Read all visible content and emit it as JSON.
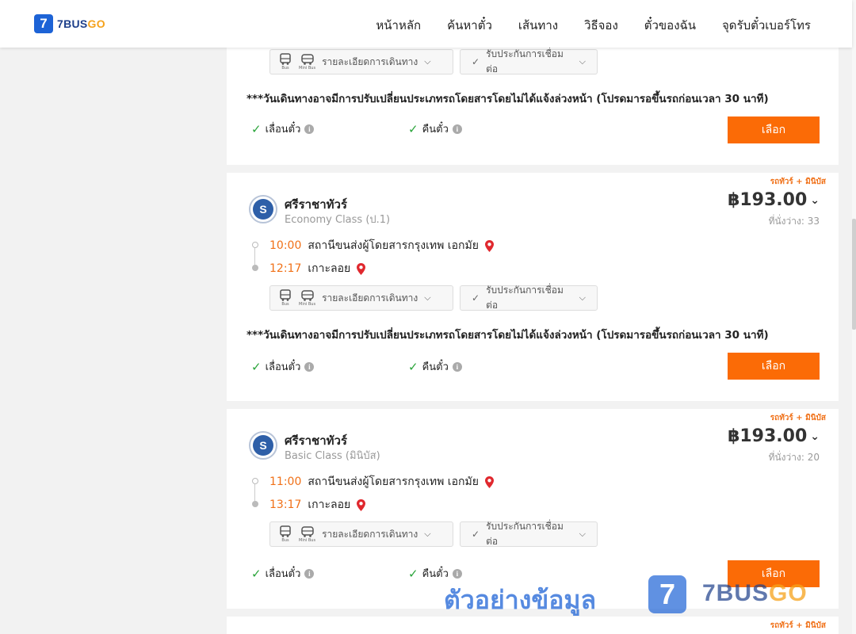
{
  "header": {
    "logo_mark": "7",
    "logo_main": "7BUS",
    "logo_accent": "GO",
    "nav": [
      "หน้าหลัก",
      "ค้นหาตั๋ว",
      "เส้นทาง",
      "วิธีจอง",
      "ตั๋วของฉัน",
      "จุดรับตั๋วเบอร์โทร"
    ]
  },
  "common": {
    "bus_label": "Bus",
    "minibus_label": "Mini Bus",
    "trip_details": "รายละเอียดการเดินทาง",
    "insurance": "รับประกันการเชื่อมต่อ",
    "notice": "***วันเดินทางอาจมีการปรับเปลี่ยนประเภทรถโดยสารโดยไม่ได้แจ้งล่วงหน้า (โปรดมารอขึ้นรถก่อนเวลา 30 นาที)",
    "reschedule": "เลื่อนตั๋ว",
    "refund": "คืนตั๋ว",
    "select": "เลือก",
    "tag": "รถทัวร์ + มินิบัส",
    "info_mark": "i"
  },
  "trips": [
    {
      "operator": "ศรีราชาทัวร์",
      "class": "Economy Class (ป.1)",
      "price": "฿193.00",
      "seats": "ที่นั่งว่าง: 33",
      "depart_time": "10:00",
      "depart_station": "สถานีขนส่งผู้โดยสารกรุงเทพ เอกมัย",
      "arrive_time": "12:17",
      "arrive_station": "เกาะลอย"
    },
    {
      "operator": "ศรีราชาทัวร์",
      "class": "Basic Class (มินิบัส)",
      "price": "฿193.00",
      "seats": "ที่นั่งว่าง: 20",
      "depart_time": "11:00",
      "depart_station": "สถานีขนส่งผู้โดยสารกรุงเทพ เอกมัย",
      "arrive_time": "13:17",
      "arrive_station": "เกาะลอย"
    }
  ],
  "watermark": {
    "text": "ตัวอย่างข้อมูล",
    "brand_main": "7BUS",
    "brand_accent": "GO"
  },
  "colors": {
    "accent": "#fb6b06",
    "brand": "#1d63d6",
    "time": "#f07017",
    "check": "#2aa43a"
  }
}
